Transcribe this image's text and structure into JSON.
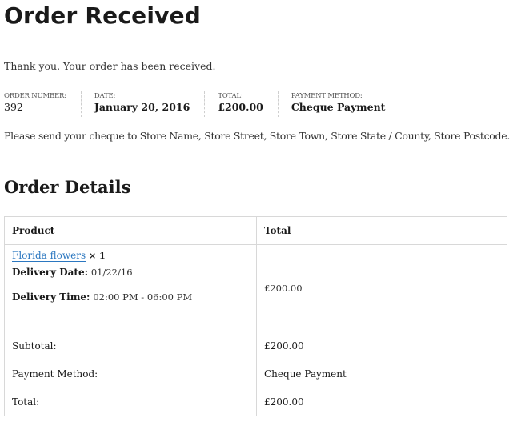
{
  "page": {
    "title": "Order Received",
    "thank_you": "Thank you. Your order has been received."
  },
  "overview": {
    "order_number": {
      "label": "Order Number:",
      "value": "392"
    },
    "date": {
      "label": "Date:",
      "value": "January 20, 2016"
    },
    "total": {
      "label": "Total:",
      "value": "£200.00"
    },
    "payment_method": {
      "label": "Payment Method:",
      "value": "Cheque Payment"
    }
  },
  "cheque_instructions": "Please send your cheque to Store Name, Store Street, Store Town, Store State / County, Store Postcode.",
  "order_details": {
    "title": "Order Details",
    "headers": {
      "product": "Product",
      "total": "Total"
    },
    "items": [
      {
        "name": "Florida flowers",
        "quantity": "× 1",
        "delivery_date_label": "Delivery Date:",
        "delivery_date": "01/22/16",
        "delivery_time_label": "Delivery Time:",
        "delivery_time": "02:00 PM - 06:00 PM",
        "total": "£200.00"
      }
    ],
    "totals": [
      {
        "label": "Subtotal:",
        "value": "£200.00"
      },
      {
        "label": "Payment Method:",
        "value": "Cheque Payment"
      },
      {
        "label": "Total:",
        "value": "£200.00"
      }
    ]
  },
  "colors": {
    "link": "#2b77c0",
    "border": "#d8d8d8",
    "text": "#1a1a1a"
  }
}
